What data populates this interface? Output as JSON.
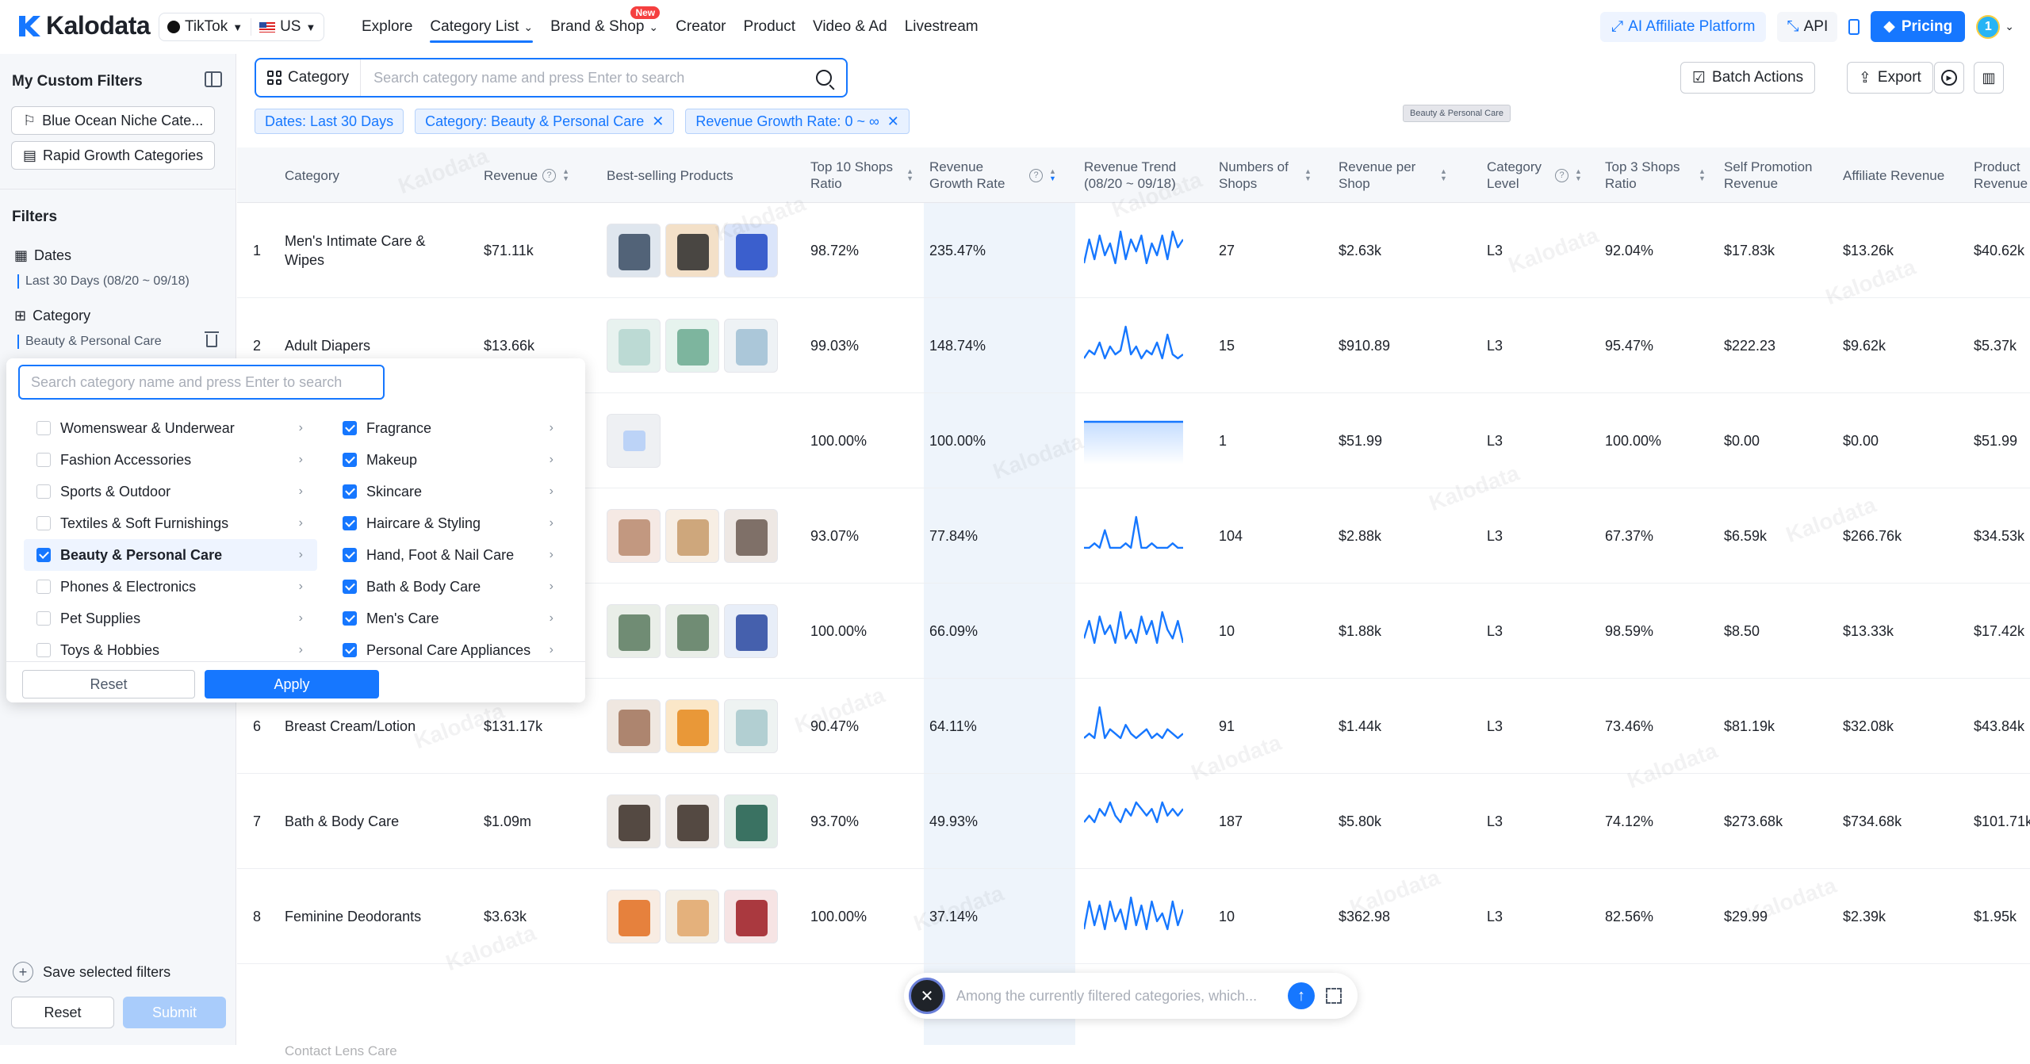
{
  "header": {
    "logo_text": "Kalodata",
    "platform": "TikTok",
    "region": "US",
    "nav": [
      {
        "label": "Explore"
      },
      {
        "label": "Category List"
      },
      {
        "label": "Brand & Shop"
      },
      {
        "label": "Creator"
      },
      {
        "label": "Product"
      },
      {
        "label": "Video & Ad"
      },
      {
        "label": "Livestream"
      }
    ],
    "new_badge": "New",
    "affiliate_label": "AI Affiliate Platform",
    "api_label": "API",
    "pricing_label": "Pricing",
    "avatar_text": "1",
    "accent_color": "#1677ff"
  },
  "sidebar": {
    "title": "My Custom Filters",
    "custom_filters": [
      "Blue Ocean Niche Cate...",
      "Rapid Growth Categories"
    ],
    "filters_title": "Filters",
    "dates_label": "Dates",
    "dates_value": "Last 30 Days (08/20 ~ 09/18)",
    "category_label": "Category",
    "category_value": "Beauty & Personal Care",
    "save_label": "Save selected filters",
    "reset_label": "Reset",
    "submit_label": "Submit"
  },
  "toolbar": {
    "category_select": "Category",
    "search_placeholder": "Search category name and press Enter to search",
    "batch_label": "Batch Actions",
    "export_label": "Export",
    "tooltip": "Beauty & Personal Care"
  },
  "tags": [
    "Dates: Last 30 Days",
    "Category: Beauty & Personal Care",
    "Revenue Growth Rate: 0 ~ ∞"
  ],
  "dropdown": {
    "search_placeholder": "Search category name and press Enter to search",
    "left": [
      {
        "label": "Womenswear & Underwear",
        "checked": false
      },
      {
        "label": "Fashion Accessories",
        "checked": false
      },
      {
        "label": "Sports & Outdoor",
        "checked": false
      },
      {
        "label": "Textiles & Soft Furnishings",
        "checked": false
      },
      {
        "label": "Beauty & Personal Care",
        "checked": true,
        "selected": true
      },
      {
        "label": "Phones & Electronics",
        "checked": false
      },
      {
        "label": "Pet Supplies",
        "checked": false
      },
      {
        "label": "Toys & Hobbies",
        "checked": false
      }
    ],
    "right": [
      {
        "label": "Fragrance",
        "checked": true
      },
      {
        "label": "Makeup",
        "checked": true
      },
      {
        "label": "Skincare",
        "checked": true
      },
      {
        "label": "Haircare & Styling",
        "checked": true
      },
      {
        "label": "Hand, Foot & Nail Care",
        "checked": true
      },
      {
        "label": "Bath & Body Care",
        "checked": true
      },
      {
        "label": "Men's Care",
        "checked": true
      },
      {
        "label": "Personal Care Appliances",
        "checked": true
      }
    ],
    "reset_label": "Reset",
    "apply_label": "Apply"
  },
  "table": {
    "columns": {
      "category": "Category",
      "revenue": "Revenue",
      "best": "Best-selling Products",
      "top10": "Top 10 Shops Ratio",
      "growth": "Revenue Growth Rate",
      "trend": "Revenue Trend (08/20 ~ 09/18)",
      "shops": "Numbers of Shops",
      "rev_shop": "Revenue per Shop",
      "level": "Category Level",
      "top3": "Top 3 Shops Ratio",
      "self": "Self Promotion Revenue",
      "aff": "Affiliate Revenue",
      "prod": "Product Revenue"
    },
    "rows": [
      {
        "rank": "1",
        "category": "Men's Intimate Care & Wipes",
        "revenue": "$71.11k",
        "top10": "98.72%",
        "growth": "235.47%",
        "shops": "27",
        "rev_shop": "$2.63k",
        "level": "L3",
        "top3": "92.04%",
        "self": "$17.83k",
        "aff": "$13.26k",
        "prod": "$40.62k",
        "trend": [
          2,
          8,
          3,
          9,
          4,
          7,
          2,
          10,
          3,
          8,
          5,
          9,
          2,
          7,
          4,
          9,
          3,
          10,
          6,
          8
        ]
      },
      {
        "rank": "2",
        "category": "Adult Diapers",
        "revenue": "$13.66k",
        "top10": "99.03%",
        "growth": "148.74%",
        "shops": "15",
        "rev_shop": "$910.89",
        "level": "L3",
        "top3": "95.47%",
        "self": "$222.23",
        "aff": "$9.62k",
        "prod": "$5.37k",
        "trend": [
          2,
          4,
          3,
          6,
          2,
          5,
          3,
          4,
          10,
          3,
          5,
          2,
          4,
          3,
          6,
          2,
          8,
          3,
          2,
          3
        ]
      },
      {
        "rank": "",
        "category": "",
        "revenue": "",
        "top10": "100.00%",
        "growth": "100.00%",
        "shops": "1",
        "rev_shop": "$51.99",
        "level": "L3",
        "top3": "100.00%",
        "self": "$0.00",
        "aff": "$0.00",
        "prod": "$51.99",
        "trend": [
          9,
          9,
          9,
          9,
          9,
          9,
          9,
          9,
          9,
          9,
          9,
          9,
          9,
          9,
          9,
          9,
          9,
          9,
          9,
          9
        ]
      },
      {
        "rank": "",
        "category": "",
        "revenue": "",
        "top10": "93.07%",
        "growth": "77.84%",
        "shops": "104",
        "rev_shop": "$2.88k",
        "level": "L3",
        "top3": "67.37%",
        "self": "$6.59k",
        "aff": "$266.76k",
        "prod": "$34.53k",
        "trend": [
          2,
          2,
          3,
          2,
          6,
          2,
          2,
          2,
          3,
          2,
          9,
          2,
          2,
          3,
          2,
          2,
          2,
          3,
          2,
          2
        ]
      },
      {
        "rank": "",
        "category": "",
        "revenue": "",
        "top10": "100.00%",
        "growth": "66.09%",
        "shops": "10",
        "rev_shop": "$1.88k",
        "level": "L3",
        "top3": "98.59%",
        "self": "$8.50",
        "aff": "$13.33k",
        "prod": "$17.42k",
        "trend": [
          3,
          7,
          2,
          8,
          4,
          6,
          2,
          9,
          3,
          5,
          2,
          8,
          4,
          7,
          2,
          9,
          5,
          3,
          7,
          2
        ]
      },
      {
        "rank": "6",
        "category": "Breast Cream/Lotion",
        "revenue": "$131.17k",
        "top10": "90.47%",
        "growth": "64.11%",
        "shops": "91",
        "rev_shop": "$1.44k",
        "level": "L3",
        "top3": "73.46%",
        "self": "$81.19k",
        "aff": "$32.08k",
        "prod": "$43.84k",
        "trend": [
          2,
          3,
          2,
          9,
          2,
          4,
          3,
          2,
          5,
          3,
          2,
          3,
          4,
          2,
          3,
          2,
          4,
          3,
          2,
          3
        ]
      },
      {
        "rank": "7",
        "category": "Bath & Body Care",
        "revenue": "$1.09m",
        "top10": "93.70%",
        "growth": "49.93%",
        "shops": "187",
        "rev_shop": "$5.80k",
        "level": "L3",
        "top3": "74.12%",
        "self": "$273.68k",
        "aff": "$734.68k",
        "prod": "$101.71k",
        "trend": [
          3,
          4,
          3,
          5,
          4,
          6,
          4,
          3,
          5,
          4,
          6,
          5,
          4,
          5,
          3,
          6,
          4,
          5,
          4,
          5
        ]
      },
      {
        "rank": "8",
        "category": "Feminine Deodorants",
        "revenue": "$3.63k",
        "top10": "100.00%",
        "growth": "37.14%",
        "shops": "10",
        "rev_shop": "$362.98",
        "level": "L3",
        "top3": "82.56%",
        "self": "$29.99",
        "aff": "$2.39k",
        "prod": "$1.95k",
        "trend": [
          2,
          9,
          3,
          8,
          2,
          9,
          4,
          7,
          2,
          10,
          3,
          8,
          2,
          9,
          4,
          6,
          2,
          9,
          3,
          7
        ]
      }
    ],
    "faded_row": "Contact Lens Care"
  },
  "ai": {
    "placeholder": "Among the currently filtered categories, which..."
  }
}
